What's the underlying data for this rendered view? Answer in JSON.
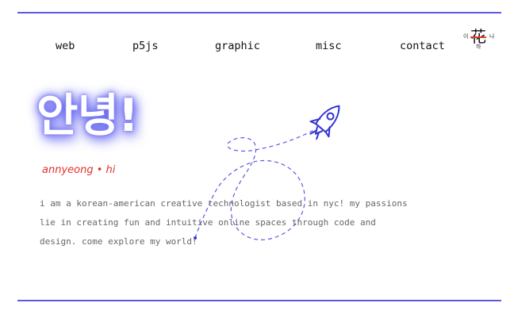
{
  "nav": {
    "items": [
      "web",
      "p5js",
      "graphic",
      "misc",
      "contact"
    ]
  },
  "logo": {
    "center_char": "花",
    "left_char": "이",
    "right_char": "나",
    "bottom_char": "하"
  },
  "hero": {
    "greeting": "안녕!",
    "subtitle": "annyeong • hi"
  },
  "intro": {
    "lines": [
      "i am a korean-american creative technologist based in nyc! my passions",
      "lie in creating fun and intuitive online spaces through code and",
      "design. come explore my world!"
    ]
  },
  "colors": {
    "accent": "#5a5ae6",
    "rocket": "#3232d6",
    "subtitle": "#e0322a",
    "glow": "#4c4cf0"
  },
  "icons": [
    "rocket-icon",
    "flower-logo-icon"
  ]
}
